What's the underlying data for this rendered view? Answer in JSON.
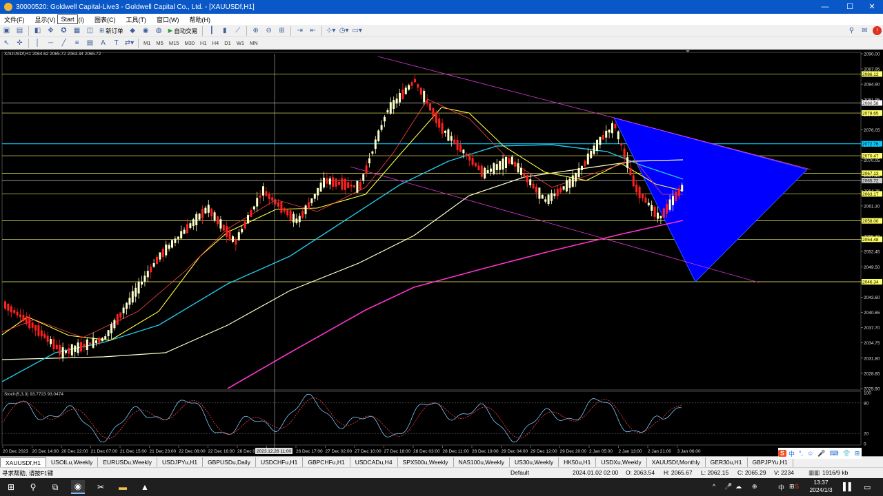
{
  "window": {
    "title": "30000520: Goldwell Capital-Live3 - Goldwell Capital Co., Ltd. - [XAUUSDf,H1]",
    "minimize": "—",
    "maximize": "☐",
    "close": "✕"
  },
  "tooltip": "Start",
  "menu": [
    "文件(F)",
    "显示(V)",
    "插入(I)",
    "图表(C)",
    "工具(T)",
    "窗口(W)",
    "帮助(H)"
  ],
  "toolbar": {
    "new_order": "新订单",
    "auto_trading": "自动交易"
  },
  "timeframes": [
    "M1",
    "M5",
    "M15",
    "M30",
    "H1",
    "H4",
    "D1",
    "W1",
    "MN"
  ],
  "chart": {
    "info": "XAUUSDf,H1  2064.62 2065.72 2063.34 2065.72",
    "price_ticks": [
      "2090.00",
      "2087.95",
      "2084.90",
      "2081.95",
      "2079.00",
      "2076.05",
      "2073.00",
      "2070.05",
      "2067.10",
      "2064.25",
      "2061.30",
      "2058.25",
      "2055.30",
      "2052.45",
      "2049.50",
      "2046.55",
      "2043.60",
      "2040.65",
      "2037.70",
      "2034.75",
      "2031.80",
      "2028.85",
      "2025.90"
    ],
    "hlines": [
      {
        "price": 2086.12,
        "label": "2086.12",
        "color": "#ffff66"
      },
      {
        "price": 2080.58,
        "label": "2080.58",
        "color": "#ffffff"
      },
      {
        "price": 2078.65,
        "label": "2078.65",
        "color": "#ffff66"
      },
      {
        "price": 2072.76,
        "label": "2072.76",
        "color": "#00ccff"
      },
      {
        "price": 2070.47,
        "label": "2070.47",
        "color": "#ffff66"
      },
      {
        "price": 2067.13,
        "label": "2067.13",
        "color": "#ffff66"
      },
      {
        "price": 2065.72,
        "label": "2065.72",
        "color": "#cccccc"
      },
      {
        "price": 2063.17,
        "label": "2063.17",
        "color": "#ffff66"
      },
      {
        "price": 2058.0,
        "label": "2058.00",
        "color": "#ffff66"
      },
      {
        "price": 2054.48,
        "label": "2054.48",
        "color": "#ffff66"
      },
      {
        "price": 2046.34,
        "label": "2046.34",
        "color": "#ffff66"
      }
    ],
    "stoch_label": "Stoch(5,3,3) 93.7723 93.0474",
    "stoch_levels": [
      "100",
      "80",
      "20",
      "0"
    ],
    "time_labels": [
      "20 Dec 2023",
      "20 Dec 14:00",
      "20 Dec 22:00",
      "21 Dec 07:00",
      "21 Dec 15:00",
      "21 Dec 23:00",
      "22 Dec 08:00",
      "22 Dec 16:00",
      "26 Dec 01:00",
      "2023.12.26 11:00",
      "26 Dec 17:00",
      "27 Dec 02:00",
      "27 Dec 10:00",
      "27 Dec 18:00",
      "28 Dec 03:00",
      "28 Dec 11:00",
      "28 Dec 19:00",
      "29 Dec 04:00",
      "29 Dec 12:00",
      "29 Dec 20:00",
      "2 Jan 05:00",
      "2 Jan 13:00",
      "2 Jan 21:00",
      "3 Jan 06:00"
    ],
    "colors": {
      "bull": "#ffffcc",
      "bear": "#ff2020",
      "ma_fast": "#ff4444",
      "ma_yellow": "#ffff44",
      "ma_cyan": "#22c8e8",
      "ma_cream": "#ffffcc",
      "ma_magenta": "#ff33cc",
      "triangle": "#0000ff"
    }
  },
  "tabs": [
    "XAUUSDf,H1",
    "USOILu,Weekly",
    "EURUSDu,Weekly",
    "USDJPYu,H1",
    "GBPUSDu,Daily",
    "USDCHFu,H1",
    "GBPCHFu,H1",
    "USDCADu,H4",
    "SPX500u,Weekly",
    "NAS100u,Weekly",
    "US30u,Weekly",
    "HK50u,H1",
    "USDXu,Weekly",
    "XAUUSDf,Monthly",
    "GER30u,H1",
    "GBPJPYu,H1"
  ],
  "ime": [
    "S",
    "中",
    "°,",
    "☺",
    "🎤",
    "⌨",
    "👕",
    "⊞"
  ],
  "status": {
    "help": "寻求帮助, 请按F1键",
    "profile": "Default",
    "datetime": "2024.01.02 02:00",
    "open": "O: 2063.54",
    "high": "H: 2065.67",
    "low": "L: 2062.15",
    "close": "C: 2065.29",
    "volume": "V: 2234",
    "traffic": "1916/9 kb"
  },
  "taskbar": {
    "time": "13:37",
    "date": "2024/1/3",
    "tray": [
      "^",
      "🎤",
      "☁",
      "⊕",
      "中",
      "⊞",
      "S"
    ]
  }
}
